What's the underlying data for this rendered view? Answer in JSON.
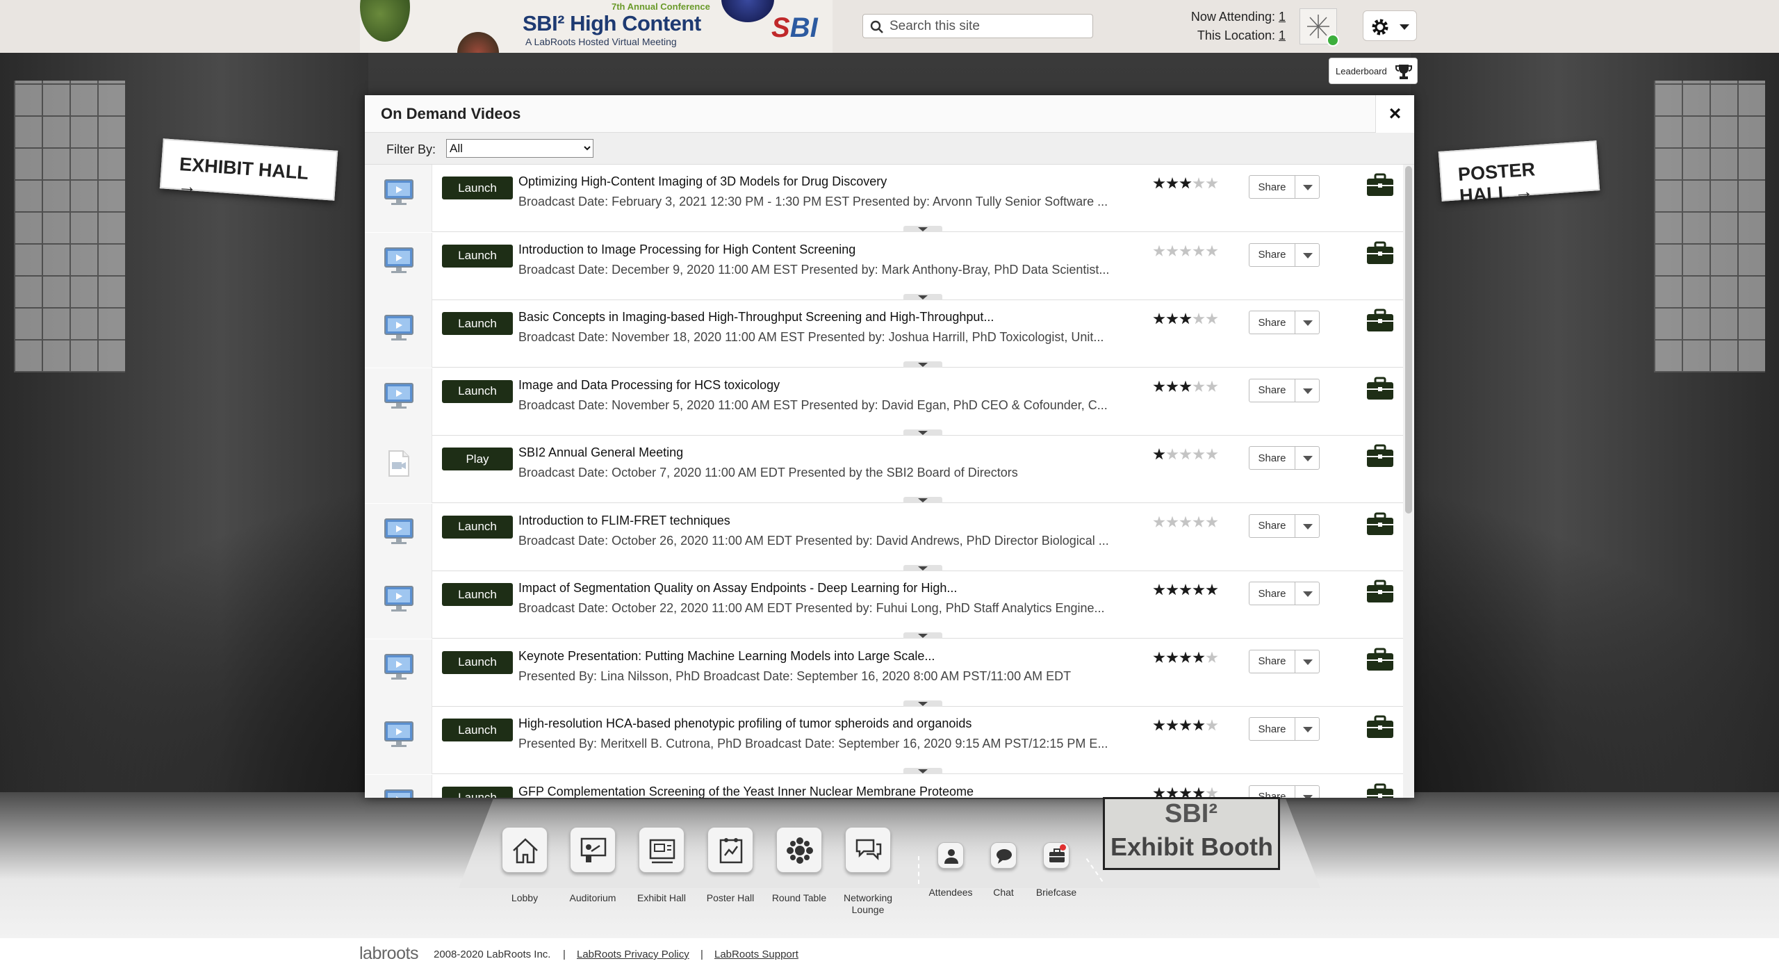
{
  "header": {
    "banner": {
      "superscript_text": "7th Annual Conference",
      "title": "SBI² High Content",
      "subtitle": "A LabRoots Hosted Virtual Meeting",
      "logo_text": "SBI"
    },
    "search": {
      "placeholder": "Search this site"
    },
    "attendance": {
      "now_attending_label": "Now Attending:",
      "now_attending_count": "1",
      "this_location_label": "This Location:",
      "this_location_count": "1"
    },
    "settings_icon": "gear-icon"
  },
  "stage": {
    "left_sign": "EXHIBIT HALL →",
    "right_sign": "POSTER HALL →",
    "leaderboard_label": "Leaderboard"
  },
  "modal": {
    "title": "On Demand Videos",
    "close_label": "×",
    "filter_label": "Filter By:",
    "filter_value": "All",
    "rows": [
      {
        "button": "Launch",
        "icon": "monitor-icon",
        "title": "Optimizing High-Content Imaging of 3D Models for Drug Discovery",
        "subtitle": "Broadcast Date: February 3, 2021 12:30 PM - 1:30 PM EST Presented by: Arvonn Tully Senior Software ...",
        "rating": 3,
        "share": "Share"
      },
      {
        "button": "Launch",
        "icon": "monitor-icon",
        "title": "Introduction to Image Processing for High Content Screening",
        "subtitle": "Broadcast Date: December 9, 2020 11:00 AM EST Presented by: Mark Anthony-Bray, PhD Data Scientist...",
        "rating": 0,
        "share": "Share"
      },
      {
        "button": "Launch",
        "icon": "monitor-icon",
        "title": "Basic Concepts in Imaging-based High-Throughput Screening and High-Throughput...",
        "subtitle": "Broadcast Date: November 18, 2020 11:00 AM EST Presented by: Joshua Harrill, PhD Toxicologist, Unit...",
        "rating": 3,
        "share": "Share"
      },
      {
        "button": "Launch",
        "icon": "monitor-icon",
        "title": "Image and Data Processing for HCS toxicology",
        "subtitle": "Broadcast Date: November 5, 2020 11:00 AM EST Presented by: David Egan, PhD CEO & Cofounder, C...",
        "rating": 3,
        "share": "Share"
      },
      {
        "button": "Play",
        "icon": "video-file-icon",
        "title": "SBI2 Annual General Meeting",
        "subtitle": "Broadcast Date: October 7, 2020 11:00 AM EDT Presented by the SBI2 Board of Directors",
        "rating": 1,
        "share": "Share"
      },
      {
        "button": "Launch",
        "icon": "monitor-icon",
        "title": "Introduction to FLIM-FRET techniques",
        "subtitle": "Broadcast Date: October 26, 2020 11:00 AM EDT Presented by: David Andrews, PhD Director Biological ...",
        "rating": 0,
        "share": "Share"
      },
      {
        "button": "Launch",
        "icon": "monitor-icon",
        "title": "Impact of Segmentation Quality on Assay Endpoints - Deep Learning for High...",
        "subtitle": "Broadcast Date: October 22, 2020 11:00 AM EDT Presented by: Fuhui Long, PhD Staff Analytics Engine...",
        "rating": 5,
        "share": "Share"
      },
      {
        "button": "Launch",
        "icon": "monitor-icon",
        "title": "Keynote Presentation: Putting Machine Learning Models into Large Scale...",
        "subtitle": "Presented By: Lina Nilsson, PhD Broadcast Date: September 16, 2020 8:00 AM PST/11:00 AM EDT",
        "rating": 4,
        "share": "Share"
      },
      {
        "button": "Launch",
        "icon": "monitor-icon",
        "title": "High-resolution HCA-based phenotypic profiling of tumor spheroids and organoids",
        "subtitle": "Presented By: Meritxell B. Cutrona, PhD Broadcast Date: September 16, 2020 9:15 AM PST/12:15 PM E...",
        "rating": 4,
        "share": "Share"
      },
      {
        "button": "Launch",
        "icon": "monitor-icon",
        "title": "GFP Complementation Screening of the Yeast Inner Nuclear Membrane Proteome",
        "subtitle": "",
        "rating": 4,
        "share": "Share"
      }
    ]
  },
  "nav": {
    "items": [
      {
        "label": "Lobby",
        "icon": "home-icon"
      },
      {
        "label": "Auditorium",
        "icon": "presenter-icon"
      },
      {
        "label": "Exhibit Hall",
        "icon": "booth-icon"
      },
      {
        "label": "Poster Hall",
        "icon": "poster-icon"
      },
      {
        "label": "Round Table",
        "icon": "round-table-icon"
      },
      {
        "label": "Networking Lounge",
        "icon": "chat-bubbles-icon"
      },
      {
        "label": "Attendees",
        "icon": "people-icon"
      },
      {
        "label": "Chat",
        "icon": "chat-icon"
      },
      {
        "label": "Briefcase",
        "icon": "briefcase-icon"
      }
    ],
    "booth_sign_line1": "SBI²",
    "booth_sign_line2": "Exhibit Booth"
  },
  "footer": {
    "logo": "labroots",
    "copyright": "2008-2020 LabRoots Inc.",
    "separator": "|",
    "privacy_link": "LabRoots Privacy Policy",
    "support_link": "LabRoots Support"
  },
  "colors": {
    "launch_button": "#1e2e16",
    "banner_title": "#1e3a72",
    "star_on": "#1a1a1a",
    "star_off": "#c4c4c4"
  }
}
